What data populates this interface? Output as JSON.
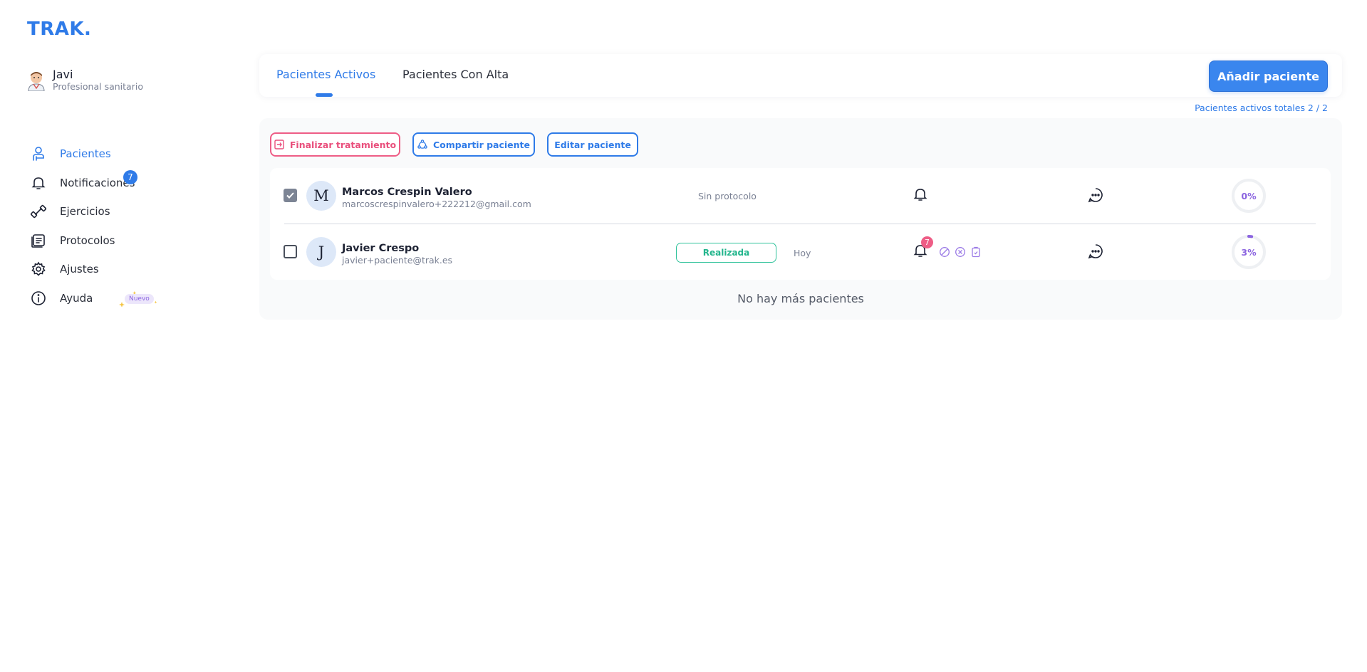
{
  "app": {
    "logo": "TRAK."
  },
  "user": {
    "name": "Javi",
    "role": "Profesional sanitario"
  },
  "sidebar": {
    "items": [
      {
        "label": "Pacientes",
        "icon": "patient-icon",
        "active": true
      },
      {
        "label": "Notificaciones",
        "icon": "bell-icon",
        "badge": "7"
      },
      {
        "label": "Ejercicios",
        "icon": "dumbbell-icon"
      },
      {
        "label": "Protocolos",
        "icon": "clipboard-icon"
      },
      {
        "label": "Ajustes",
        "icon": "gear-icon"
      },
      {
        "label": "Ayuda",
        "icon": "info-icon",
        "badge": "Nuevo"
      }
    ]
  },
  "tabs": [
    {
      "label": "Pacientes Activos",
      "active": true
    },
    {
      "label": "Pacientes Con Alta",
      "active": false
    }
  ],
  "header": {
    "add_button": "Añadir paciente",
    "total_count": "Pacientes activos totales 2 / 2"
  },
  "actions": {
    "finish": "Finalizar tratamiento",
    "share": "Compartir paciente",
    "edit": "Editar paciente"
  },
  "patients": [
    {
      "initial": "M",
      "name": "Marcos Crespin Valero",
      "email": "marcoscrespinvalero+222212@gmail.com",
      "selected": true,
      "protocol": "Sin protocolo",
      "status": null,
      "date": null,
      "notifications": null,
      "progress_label": "0%",
      "progress": 0
    },
    {
      "initial": "J",
      "name": "Javier Crespo",
      "email": "javier+paciente@trak.es",
      "selected": false,
      "protocol": null,
      "status": "Realizada",
      "date": "Hoy",
      "notifications": "7",
      "progress_label": "3%",
      "progress": 0.03
    }
  ],
  "footer": {
    "no_more": "No hay más pacientes"
  },
  "colors": {
    "primary": "#2f7be8",
    "danger": "#ee5d86",
    "success": "#2ec29a",
    "progress": "#8b64e0"
  }
}
